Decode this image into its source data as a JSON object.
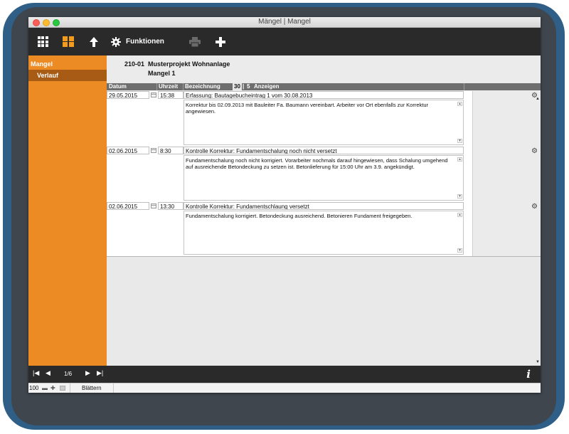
{
  "window": {
    "title": "Mängel | Mangel"
  },
  "toolbar": {
    "functions_label": "Funktionen"
  },
  "sidebar": {
    "items": [
      {
        "label": "Mangel"
      },
      {
        "label": "Verlauf"
      }
    ]
  },
  "header": {
    "project_id": "210-01",
    "project_name": "Musterprojekt Wohnanlage",
    "mangel_title": "Mangel 1"
  },
  "columns": {
    "datum": "Datum",
    "uhrzeit": "Uhrzeit",
    "bezeichnung": "Bezeichnung",
    "count": "30",
    "separator": "|",
    "page_size": "5",
    "show": "Anzeigen"
  },
  "entries": [
    {
      "date": "29.05.2015",
      "time": "15:38",
      "title": "Erfassung: Bautagebucheintrag 1 vom 30.08.2013",
      "text": "Korrektur bis 02.09.2013 mit Bauleiter Fa. Baumann vereinbart. Arbeiter vor Ort ebenfalls zur Korrektur angewiesen."
    },
    {
      "date": "02.06.2015",
      "time": "8:30",
      "title": "Kontrolle Korrektur: Fundamentschalung noch nicht versetzt",
      "text": "Fundamentschalung noch nicht korrigiert. Vorarbeiter nochmals darauf hingewiesen, dass Schalung umgehend auf ausreichende Betondeckung zu setzen ist. Betonlieferung für 15:00 Uhr am 3.9. angekündigt."
    },
    {
      "date": "02.06.2015",
      "time": "13:30",
      "title": "Kontrolle Korrektur: Fundamentschlaung versetzt",
      "text": "Fundamentschalung korrigiert. Betondeckung ausreichend. Betonieren Fundament freigegeben."
    }
  ],
  "pager": {
    "position": "1/6"
  },
  "status": {
    "zoom": "100",
    "mode": "Blättern"
  },
  "icons": {
    "first": "first-record-icon",
    "prev": "prev-record-icon",
    "next": "next-record-icon",
    "last": "last-record-icon",
    "info": "info-icon",
    "gear": "gear-icon"
  },
  "colors": {
    "accent": "#ec8a24",
    "sidebar_active": "#a85b14",
    "toolbar": "#2a2a2a",
    "column_header": "#6e6e6e",
    "frame": "#2f5f86"
  }
}
